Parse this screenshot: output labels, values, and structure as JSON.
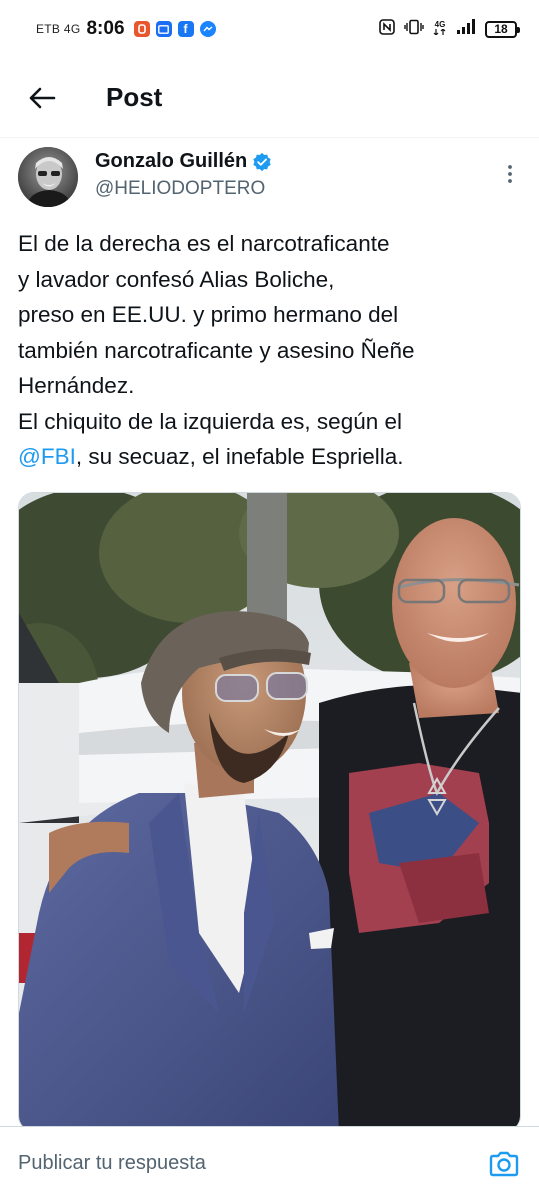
{
  "status_bar": {
    "carrier": "ETB 4G",
    "time": "8:06",
    "network": "4G",
    "battery": "18"
  },
  "header": {
    "title": "Post"
  },
  "post": {
    "author_name": "Gonzalo Guillén",
    "author_handle": "@HELIODOPTERO",
    "text_lines": [
      "El de la derecha es el narcotraficante",
      "y lavador confesó Alias Boliche,",
      "preso en EE.UU. y primo hermano del",
      "también narcotraficante y asesino Ñeñe",
      "Hernández.",
      "El chiquito de la izquierda es, según el"
    ],
    "mention": "@FBI",
    "text_tail": ",  su secuaz, el inefable Espriella."
  },
  "reply": {
    "placeholder": "Publicar tu respuesta"
  },
  "colors": {
    "link_blue": "#1d9bf0",
    "text_primary": "#0f1419",
    "text_secondary": "#536471",
    "divider": "#eff3f4"
  },
  "icons": {
    "back": "arrow-left-icon",
    "verified": "verified-badge-icon",
    "more": "more-vertical-icon",
    "camera": "camera-icon"
  }
}
